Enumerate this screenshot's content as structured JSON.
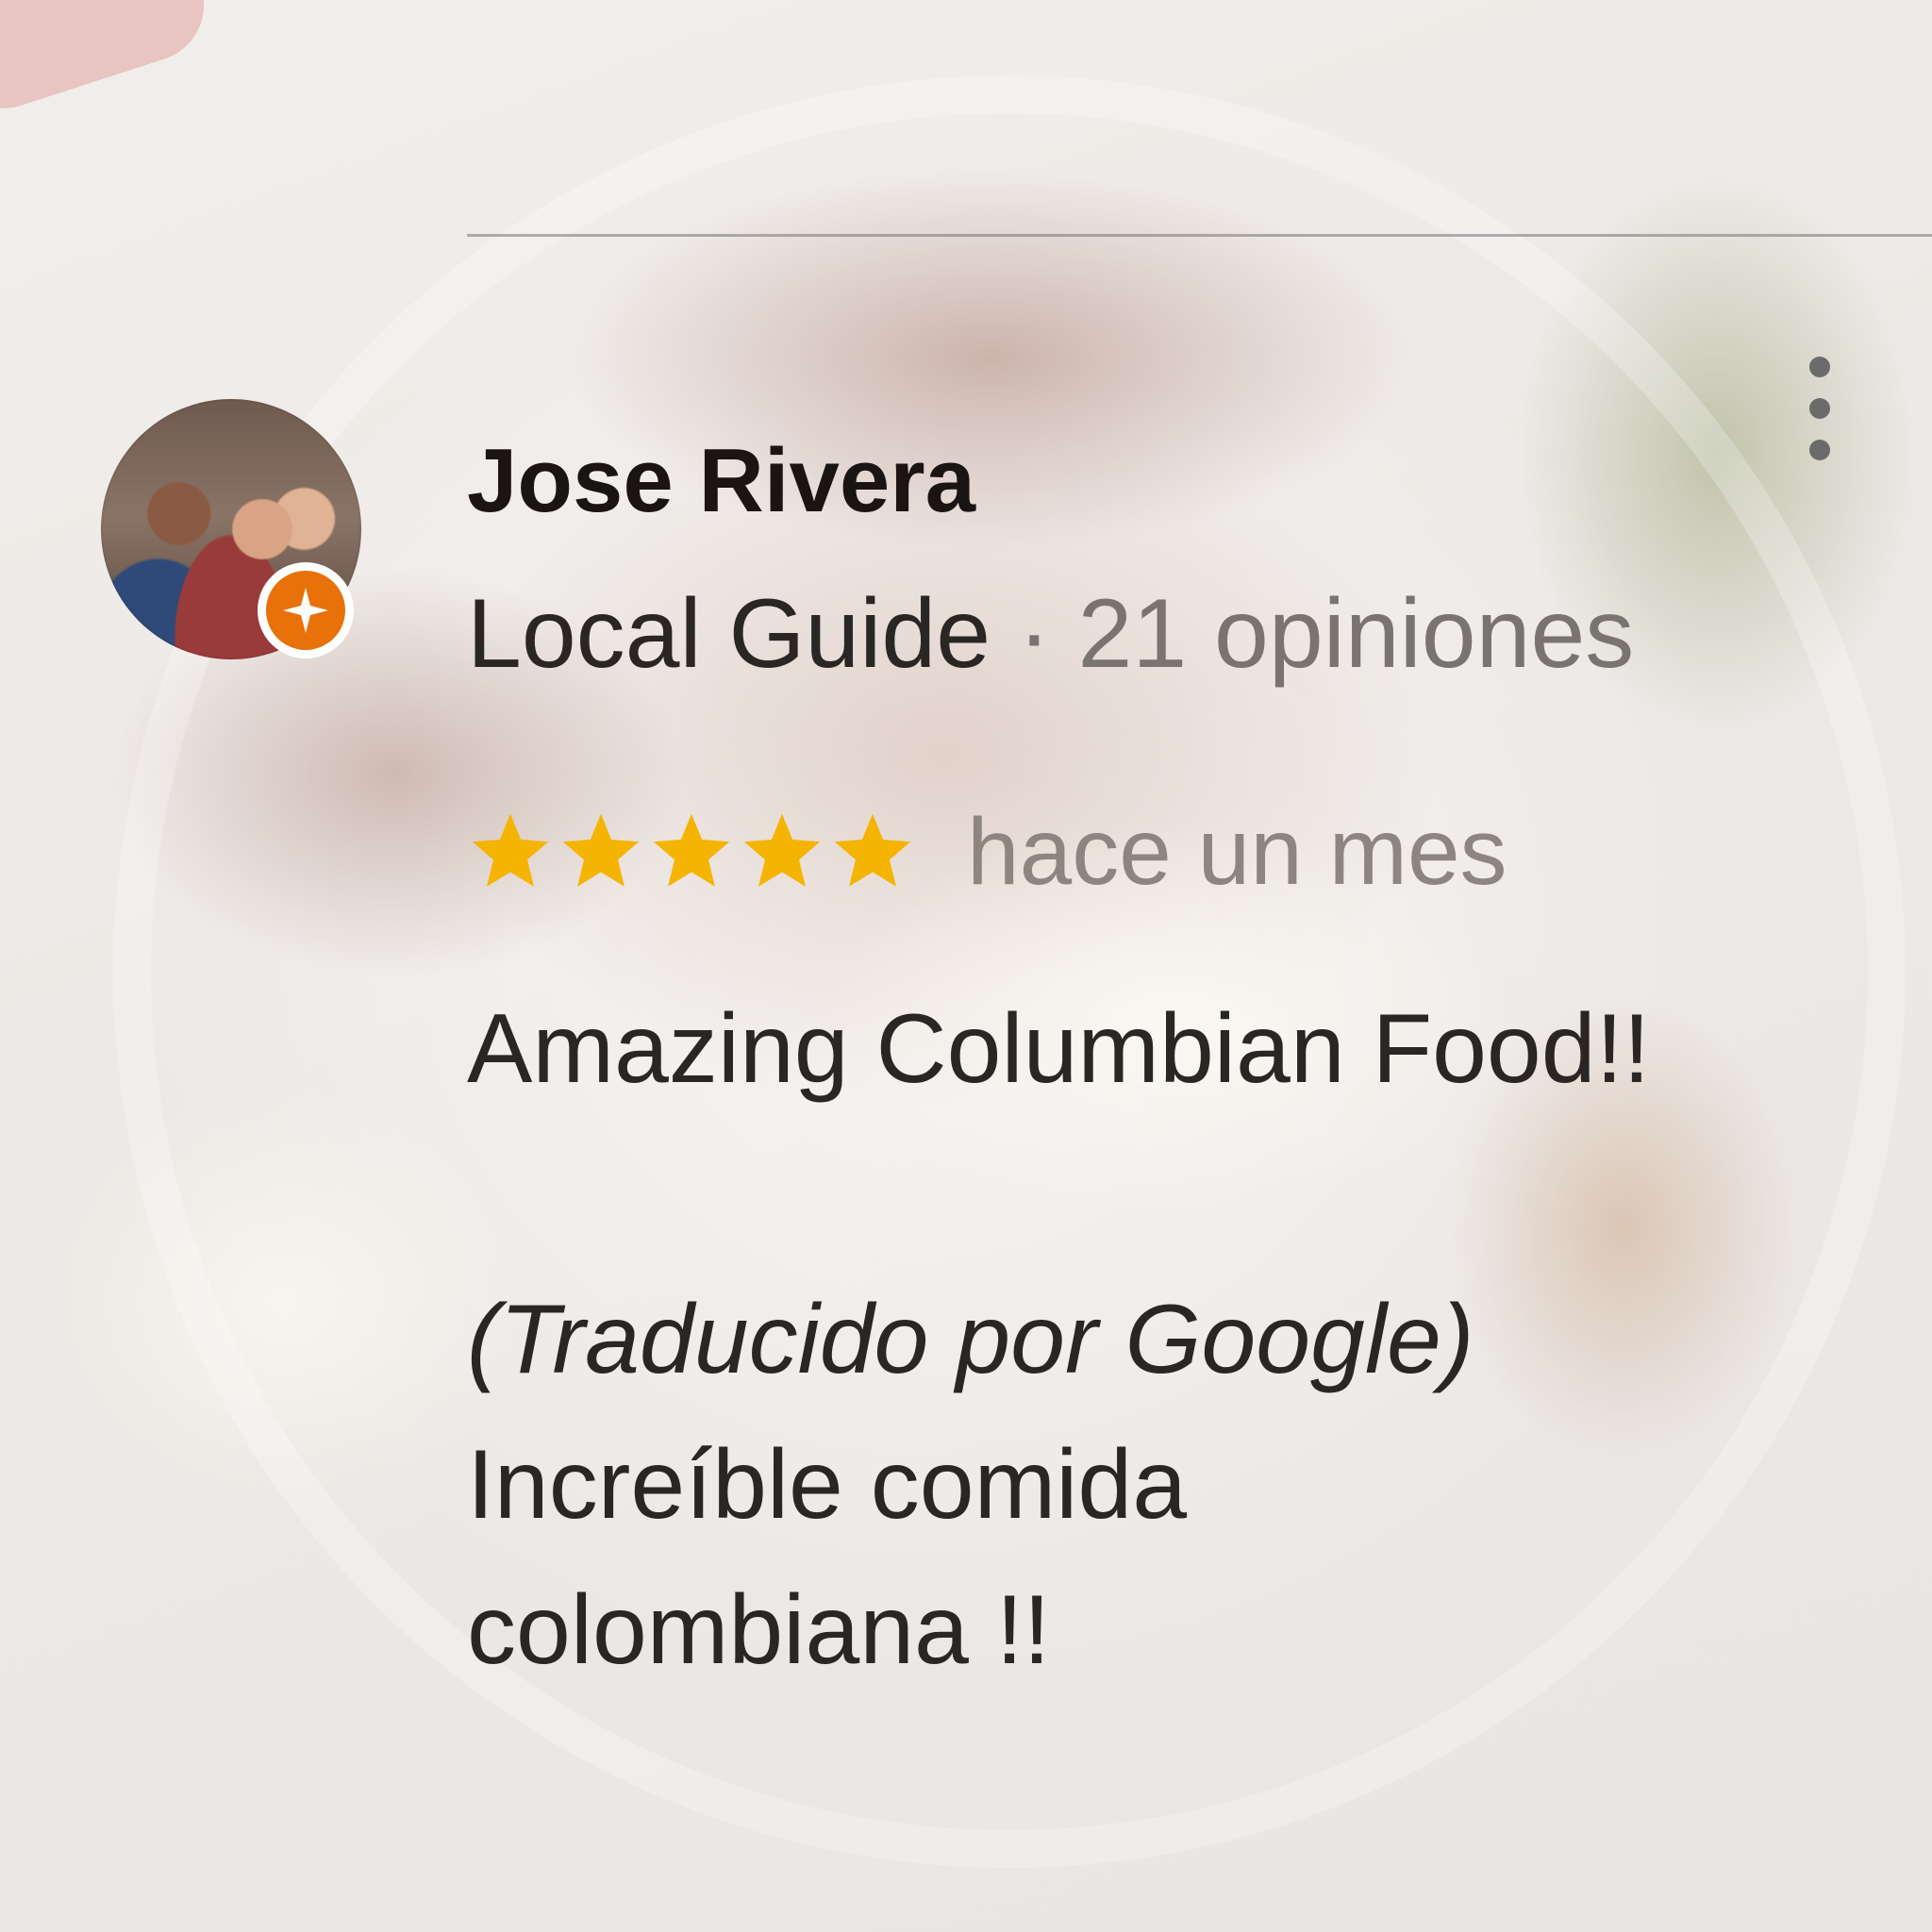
{
  "review": {
    "author": {
      "name": "Jose Rivera",
      "level": "Local Guide",
      "separator": "·",
      "review_count": "21 opiniones",
      "avatar_icon": "profile-photo",
      "badge_icon": "local-guide-star-badge",
      "badge_color": "#e8710a"
    },
    "rating": {
      "stars": 5,
      "max_stars": 5,
      "star_color": "#f4b400",
      "time_ago": "hace un mes"
    },
    "text": {
      "original": "Amazing Columbian Food!!",
      "translated_note": "(Traducido por Google)",
      "translated_line1": "Increíble comida",
      "translated_line2": "colombiana !!"
    },
    "menu_icon": "more-vert-icon"
  }
}
